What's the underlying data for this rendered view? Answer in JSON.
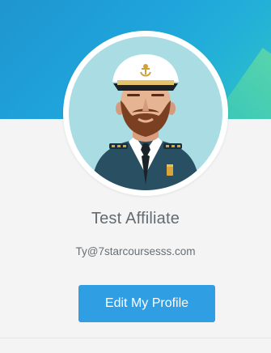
{
  "profile": {
    "name": "Test Affiliate",
    "email": "Ty@7starcoursesss.com",
    "edit_button_label": "Edit My Profile"
  },
  "avatar": {
    "icon": "captain-avatar-icon"
  },
  "colors": {
    "banner": "#1fa4db",
    "button": "#2f9ee3",
    "card_background": "#f4f4f4",
    "avatar_background": "#a9dde3"
  }
}
